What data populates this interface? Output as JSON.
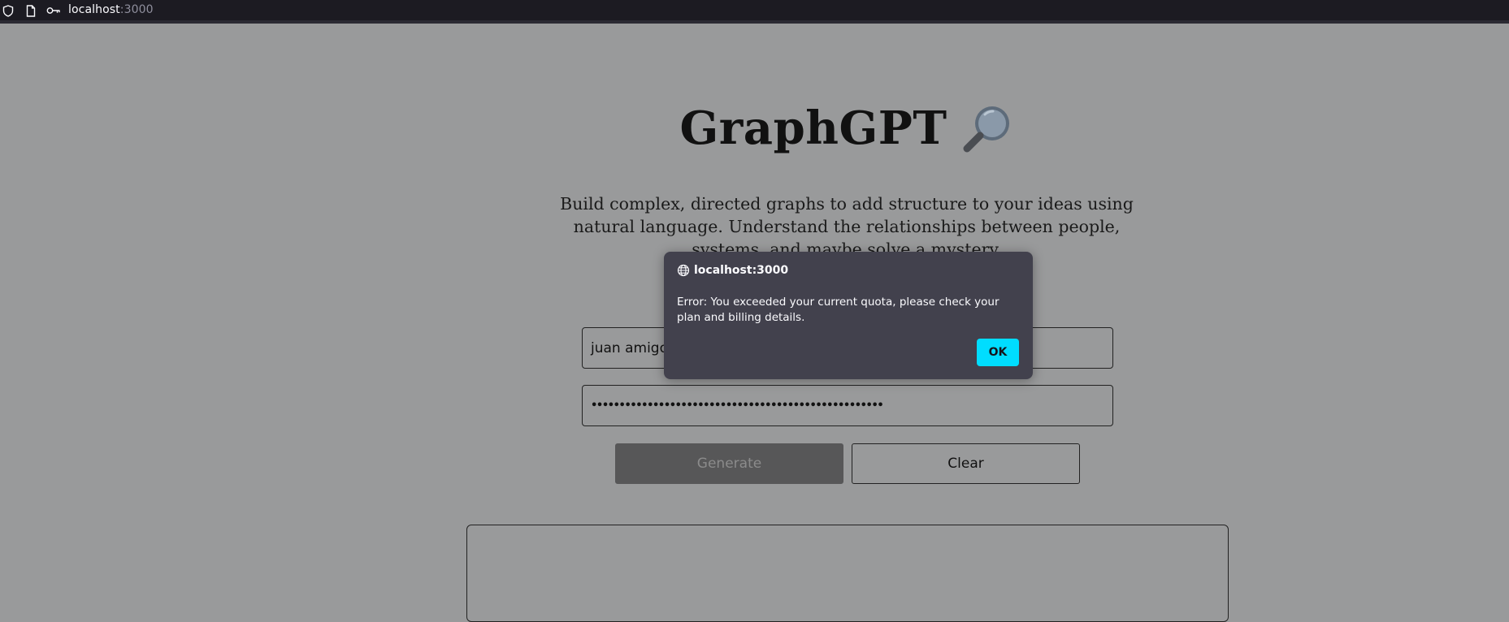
{
  "browser": {
    "url_host": "localhost",
    "url_port": ":3000"
  },
  "page": {
    "title": "GraphGPT",
    "tagline": "Build complex, directed graphs to add structure to your ideas using natural language. Understand the relationships between people, systems, and maybe solve a mystery.",
    "name_input_value": "juan amigo",
    "key_input_value": "••••••••••••••••••••••••••••••••••••••••••••••••••••",
    "generate_label": "Generate",
    "clear_label": "Clear"
  },
  "dialog": {
    "origin": "localhost:3000",
    "message": "Error: You exceeded your current quota, please check your plan and billing details.",
    "ok_label": "OK"
  },
  "colors": {
    "page_background": "#999a9b",
    "dialog_background": "#42414d",
    "ok_button": "#00ddff",
    "generate_button_disabled": "#575758"
  },
  "icons": {
    "title_emoji": "magnifying-glass-icon",
    "urlbar": [
      "shield-icon",
      "page-icon",
      "key-icon"
    ],
    "dialog": "globe-icon"
  }
}
